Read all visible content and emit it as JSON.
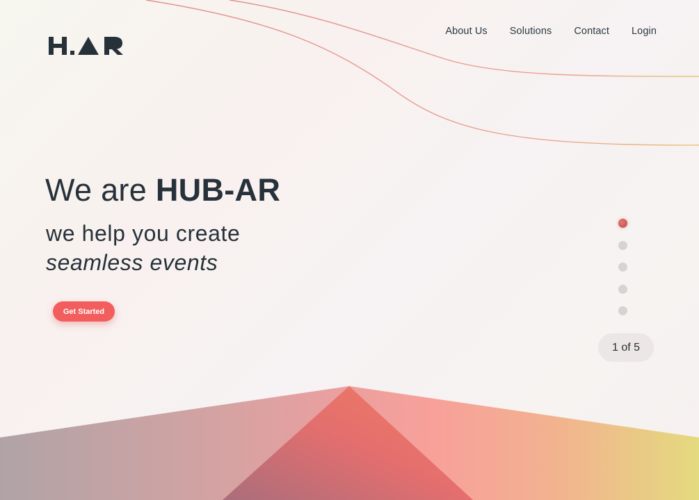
{
  "logo": {
    "text": "H.AR"
  },
  "nav": {
    "items": [
      {
        "label": "About Us"
      },
      {
        "label": "Solutions"
      },
      {
        "label": "Contact"
      },
      {
        "label": "Login"
      }
    ]
  },
  "hero": {
    "title_prefix": "We are ",
    "title_strong": "HUB-AR",
    "subtitle_line1": "we help you create",
    "subtitle_line2": "seamless events",
    "cta_label": "Get Started"
  },
  "slider": {
    "current": 1,
    "total": 5,
    "counter_text": "1 of 5"
  },
  "colors": {
    "accent": "#f25d5d",
    "text": "#27313a",
    "dot_inactive": "#d8d3d3",
    "curve": "#e79a9a"
  }
}
